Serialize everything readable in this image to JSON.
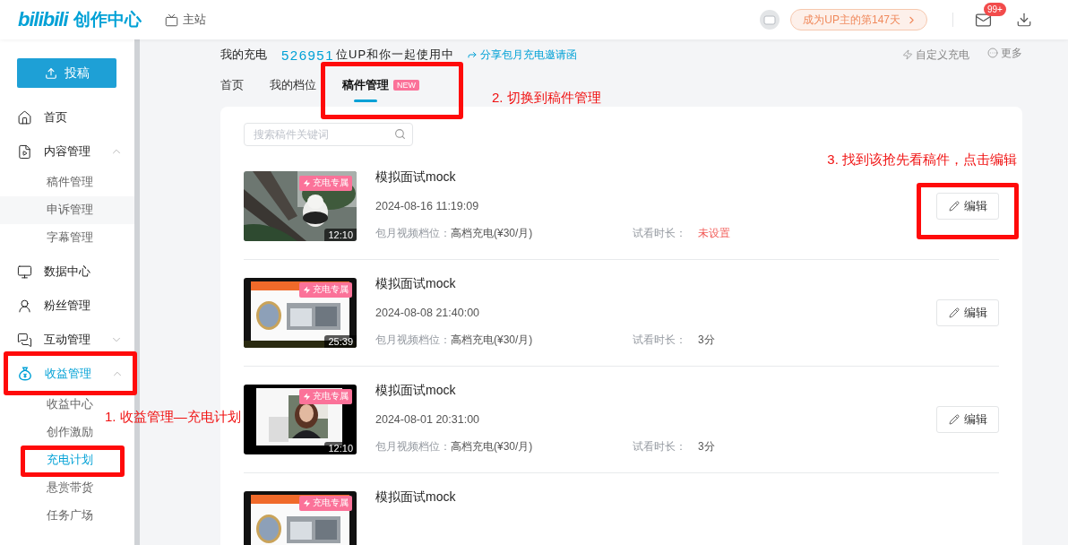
{
  "header": {
    "logo_text": "bilibili",
    "title": "创作中心",
    "main_site": "主站",
    "days_badge": "成为UP主的第147天",
    "notification_count": "99+"
  },
  "sidebar": {
    "upload_button": "投稿",
    "items": [
      {
        "label": "首页",
        "selected": false,
        "highlighted": false
      },
      {
        "label": "内容管理",
        "selected": false,
        "expanded": true,
        "highlighted": false,
        "children": [
          {
            "label": "稿件管理",
            "selected": false,
            "hovered": false,
            "highlighted": false
          },
          {
            "label": "申诉管理",
            "selected": false,
            "hovered": true,
            "highlighted": false
          },
          {
            "label": "字幕管理",
            "selected": false,
            "hovered": false,
            "highlighted": false
          }
        ]
      },
      {
        "label": "数据中心",
        "selected": false,
        "highlighted": false
      },
      {
        "label": "粉丝管理",
        "selected": false,
        "highlighted": false
      },
      {
        "label": "互动管理",
        "selected": false,
        "expanded": false,
        "highlighted": false
      },
      {
        "label": "收益管理",
        "selected": true,
        "expanded": true,
        "highlighted": true,
        "children": [
          {
            "label": "收益中心",
            "selected": false,
            "hovered": false,
            "highlighted": false
          },
          {
            "label": "创作激励",
            "selected": false,
            "hovered": false,
            "highlighted": false
          },
          {
            "label": "充电计划",
            "selected": true,
            "hovered": false,
            "highlighted": true,
            "callout": "1. 收益管理—充电计划"
          },
          {
            "label": "悬赏带货",
            "selected": false,
            "hovered": false,
            "highlighted": false
          },
          {
            "label": "任务广场",
            "selected": false,
            "hovered": false,
            "highlighted": false
          }
        ]
      }
    ]
  },
  "summary": {
    "label": "我的充电",
    "count": "526951",
    "text": "位UP和你一起使用中",
    "share_link": "分享包月充电邀请函",
    "custom_link": "自定义充电",
    "more_link": "更多"
  },
  "tabs": {
    "highlighted": true,
    "callout": "2. 切换到稿件管理",
    "items": [
      {
        "label": "首页",
        "selected": false
      },
      {
        "label": "我的档位",
        "selected": false
      },
      {
        "label": "稿件管理",
        "selected": true,
        "badge": "NEW"
      }
    ]
  },
  "search": {
    "placeholder": "搜索稿件关键词"
  },
  "videos": [
    {
      "title": "模拟面试mock",
      "date": "2024-08-16 11:19:09",
      "badge": "充电专属",
      "duration": "12:10",
      "tier_label": "包月视频档位：",
      "tier": "高档充电(¥30/月)",
      "trial_label": "试看时长：",
      "trial": "未设置",
      "trial_set": false,
      "edit_button": "编辑",
      "highlighted": true,
      "callout": "3. 找到该抢先看稿件，点击编辑"
    },
    {
      "title": "模拟面试mock",
      "date": "2024-08-08 21:40:00",
      "badge": "充电专属",
      "duration": "25:39",
      "tier_label": "包月视频档位：",
      "tier": "高档充电(¥30/月)",
      "trial_label": "试看时长：",
      "trial": "3分",
      "trial_set": true,
      "edit_button": "编辑",
      "highlighted": false
    },
    {
      "title": "模拟面试mock",
      "date": "2024-08-01 20:31:00",
      "badge": "充电专属",
      "duration": "12:10",
      "tier_label": "包月视频档位：",
      "tier": "高档充电(¥30/月)",
      "trial_label": "试看时长：",
      "trial": "3分",
      "trial_set": true,
      "edit_button": "编辑",
      "highlighted": false
    },
    {
      "title": "模拟面试mock",
      "badge": "充电专属",
      "highlighted": false
    }
  ]
}
